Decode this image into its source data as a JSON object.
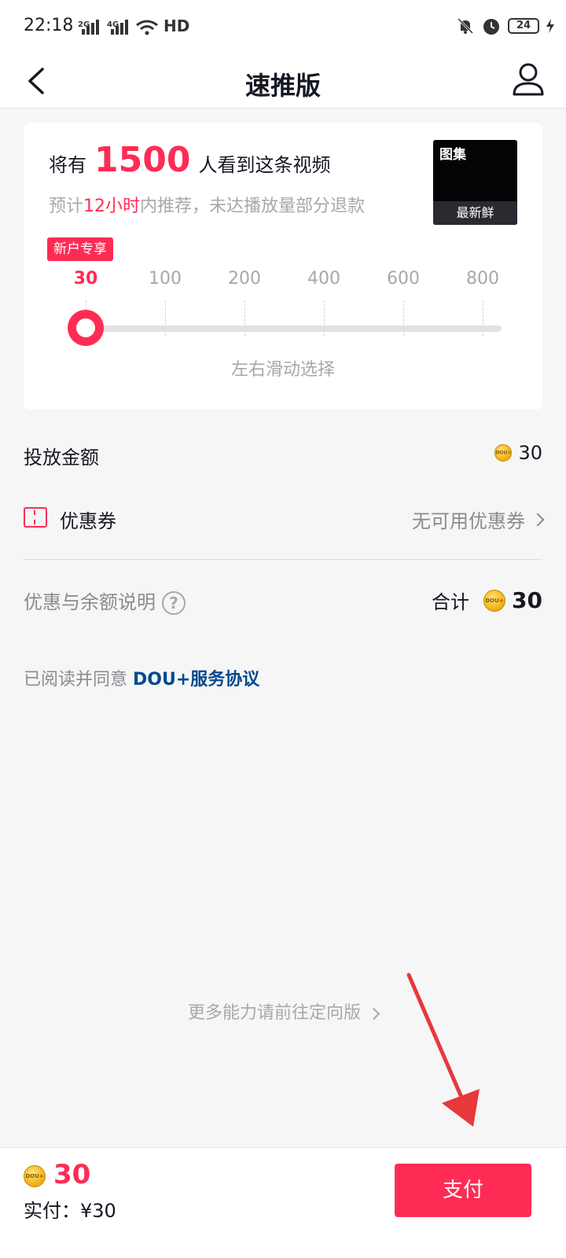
{
  "status_bar": {
    "time": "22:18",
    "sig1": "2G",
    "sig2": "4G",
    "hd": "HD",
    "battery": "24"
  },
  "nav": {
    "title": "速推版"
  },
  "card": {
    "reach_prefix": "将有",
    "reach_count": "1500",
    "reach_suffix": "人看到这条视频",
    "sub_prefix": "预计",
    "sub_highlight": "12小时",
    "sub_suffix": "内推荐，未达播放量部分退款",
    "thumb_tag": "图集",
    "thumb_caption": "最新鲜",
    "badge": "新户专享",
    "ticks": [
      "30",
      "100",
      "200",
      "400",
      "600",
      "800"
    ],
    "selected_index": 0,
    "slider_value": 30,
    "hint": "左右滑动选择"
  },
  "amount_row": {
    "label": "投放金额",
    "value": "30"
  },
  "coupon_row": {
    "label": "优惠券",
    "value": "无可用优惠券"
  },
  "summary_row": {
    "label": "优惠与余额说明",
    "help": "?",
    "total_label": "合计",
    "total_value": "30"
  },
  "agreement": {
    "prefix": "已阅读并同意 ",
    "link": "DOU+服务协议"
  },
  "more_link": "更多能力请前往定向版",
  "bottom": {
    "total": "30",
    "paid_label": "实付：¥30",
    "pay_button": "支付"
  },
  "colors": {
    "accent": "#fe2c55",
    "link": "#04498d",
    "annotation_arrow": "#e8383b"
  }
}
